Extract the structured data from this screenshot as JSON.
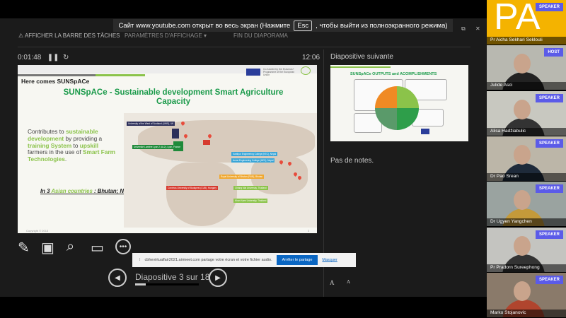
{
  "toolbar": {
    "taskbar": "AFFICHER LA BARRE DES TÂCHES",
    "display_settings": "PARAMÈTRES D'AFFICHAGE ▾",
    "end_show": "FIN DU DIAPORAMA"
  },
  "fullscreen_toast": {
    "before": "Сайт www.youtube.com открыт во весь экран (Нажмите",
    "key": "Esc",
    "after": ", чтобы выйти из полноэкранного режима)"
  },
  "presenter": {
    "elapsed": "0:01:48",
    "clock": "12:06",
    "next_label": "Diapositive suivante",
    "notes": "Pas de notes.",
    "slide_counter": "Diapositive 3 sur 18",
    "progress_fraction": 0.17
  },
  "slide": {
    "heading": "Here comes SUNSpACe",
    "title": "SUNSpACe - Sustainable development Smart Agriculture Capacity",
    "eu_text": "Co-funded by the Erasmus+ Programme of the European Union",
    "contrib": [
      {
        "t": "Contributes to ",
        "g": false
      },
      {
        "t": "sustainable development",
        "g": true
      },
      {
        "t": " by providing a ",
        "g": false
      },
      {
        "t": "training System",
        "g": true
      },
      {
        "t": " to ",
        "g": false
      },
      {
        "t": "upskill",
        "g": true
      },
      {
        "t": " farmers in the use of ",
        "g": false
      },
      {
        "t": "Smart Farm Technologies",
        "g": true
      },
      {
        "t": ".",
        "g": false
      }
    ],
    "countries_pre": "In 3 ",
    "countries_asian": "Asian countries",
    "countries_post": " : Bhutan; Nepal; Thailand",
    "map_labels": [
      {
        "text": "University of the West of Scotland (UWS), UK",
        "color": "#2c2f5a"
      },
      {
        "text": "Université Lumière Lyon 2 (UL2), Lyon, France",
        "color": "#1f8a3a"
      },
      {
        "text": "Corvinus University of Budapest (CUB), Hungary",
        "color": "#d63b2f"
      },
      {
        "text": "Kantipur Engineering College (KEC), Nepal",
        "color": "#3aa6d8"
      },
      {
        "text": "Acme Engineering College (AEC), Nepal",
        "color": "#3aa6d8"
      },
      {
        "text": "Royal University of Bhutan (RUB), Bhutan",
        "color": "#f0a830"
      },
      {
        "text": "Chiang Mai University, Thailand",
        "color": "#8bc34a"
      },
      {
        "text": "Khon Kaen University, Thailand",
        "color": "#8bc34a"
      }
    ],
    "copyright": "Copyright © 2013",
    "page": "3"
  },
  "next_slide": {
    "title": "SUNSpACe OUTPUTS and ACOMPLISHMENTS"
  },
  "share_bar": {
    "message": "cbhevirtualfair2021.airmeet.com partage votre écran et votre fichier audio.",
    "stop": "Arrêter le partage",
    "hide": "Masquer"
  },
  "font_buttons": [
    "A",
    "A"
  ],
  "participants": [
    {
      "name": "Pr Aicha Sekhari Seklouli",
      "role": "SPEAKER",
      "initials": "PA"
    },
    {
      "name": "Julide Asci",
      "role": "HOST"
    },
    {
      "name": "Alisa Hadžiabulic",
      "role": "SPEAKER"
    },
    {
      "name": "Dr Pao Srean",
      "role": "SPEAKER"
    },
    {
      "name": "Dr Ugyen Yangchen",
      "role": "SPEAKER"
    },
    {
      "name": "Pr Pradorn Sureephong",
      "role": "SPEAKER"
    },
    {
      "name": "Marko Stojanovic",
      "role": "SPEAKER"
    }
  ],
  "colors": {
    "accent_green": "#1a9a4a",
    "light_green": "#8bc34a",
    "badge": "#5b5be8",
    "initials_bg": "#f4b300",
    "share_blue": "#0a66c2"
  }
}
